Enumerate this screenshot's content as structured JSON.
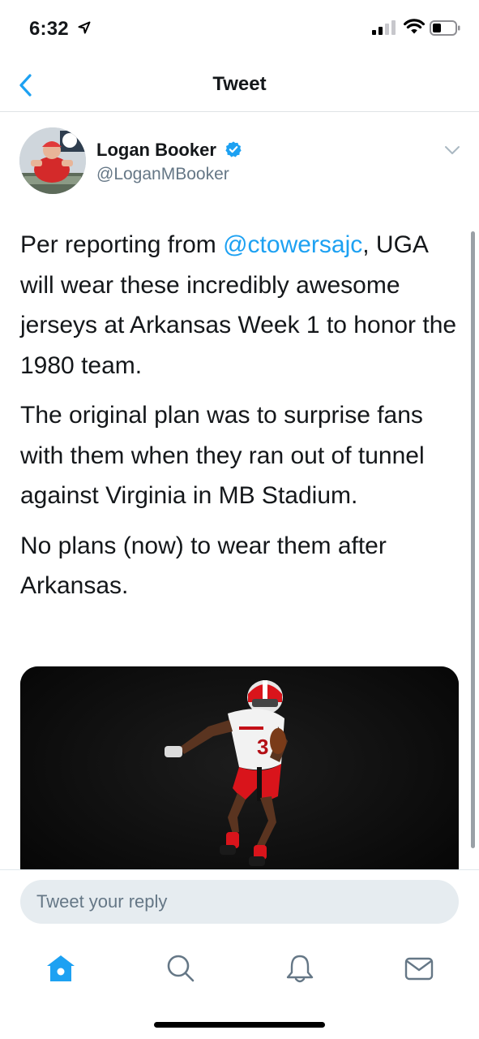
{
  "status_bar": {
    "time": "6:32",
    "icons": [
      "location-arrow-icon",
      "cellular-signal-icon",
      "wifi-icon",
      "battery-icon"
    ]
  },
  "nav": {
    "title": "Tweet",
    "back_icon": "chevron-left-icon"
  },
  "tweet": {
    "author": {
      "name": "Logan Booker",
      "handle": "@LoganMBooker",
      "verified": true
    },
    "paragraphs": [
      {
        "prefix": "Per reporting from ",
        "mention": "@ctowersajc",
        "suffix": ", UGA will wear these incredibly awesome jerseys at Arkansas Week 1 to honor the 1980 team."
      },
      {
        "text": "The original plan was to surprise fans with them when they ran out of tunnel against Virginia in MB Stadium."
      },
      {
        "text": "No plans (now) to wear them after Arkansas."
      }
    ],
    "media_description_icon": "football-player-photo"
  },
  "reply": {
    "placeholder": "Tweet your reply"
  },
  "tabs": [
    {
      "name": "home",
      "icon": "home-icon",
      "active": true
    },
    {
      "name": "search",
      "icon": "search-icon",
      "active": false
    },
    {
      "name": "notifications",
      "icon": "bell-icon",
      "active": false
    },
    {
      "name": "messages",
      "icon": "mail-icon",
      "active": false
    }
  ],
  "colors": {
    "accent": "#1da1f2",
    "text": "#14171a",
    "secondary": "#657786",
    "reply_bg": "#e6ecf0"
  }
}
